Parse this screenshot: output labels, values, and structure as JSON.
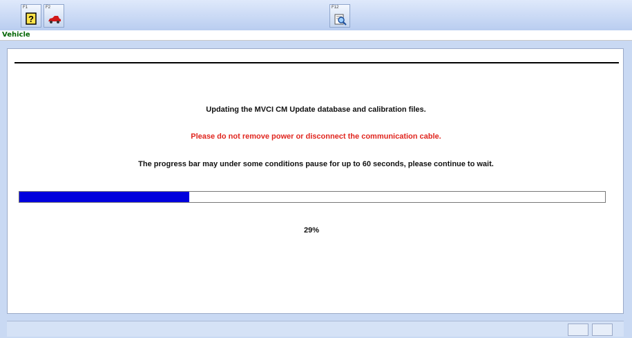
{
  "toolbar": {
    "buttons": [
      {
        "key": "F1",
        "icon": "help-icon"
      },
      {
        "key": "F2",
        "icon": "vehicle-icon"
      },
      {
        "key": "F12",
        "icon": "print-preview-icon"
      }
    ]
  },
  "vehicle_bar": {
    "label": "Vehicle"
  },
  "main": {
    "message1": "Updating the MVCI CM Update database and calibration files.",
    "message2": "Please do not remove power or disconnect the communication cable.",
    "message3": "The progress bar may under some conditions pause for up to 60 seconds, please continue to wait.",
    "progress": {
      "fraction": 0.29,
      "label": "29%"
    }
  },
  "colors": {
    "warning": "#e0261f",
    "progress_fill": "#0000dd",
    "vehicle_label": "#006400"
  }
}
